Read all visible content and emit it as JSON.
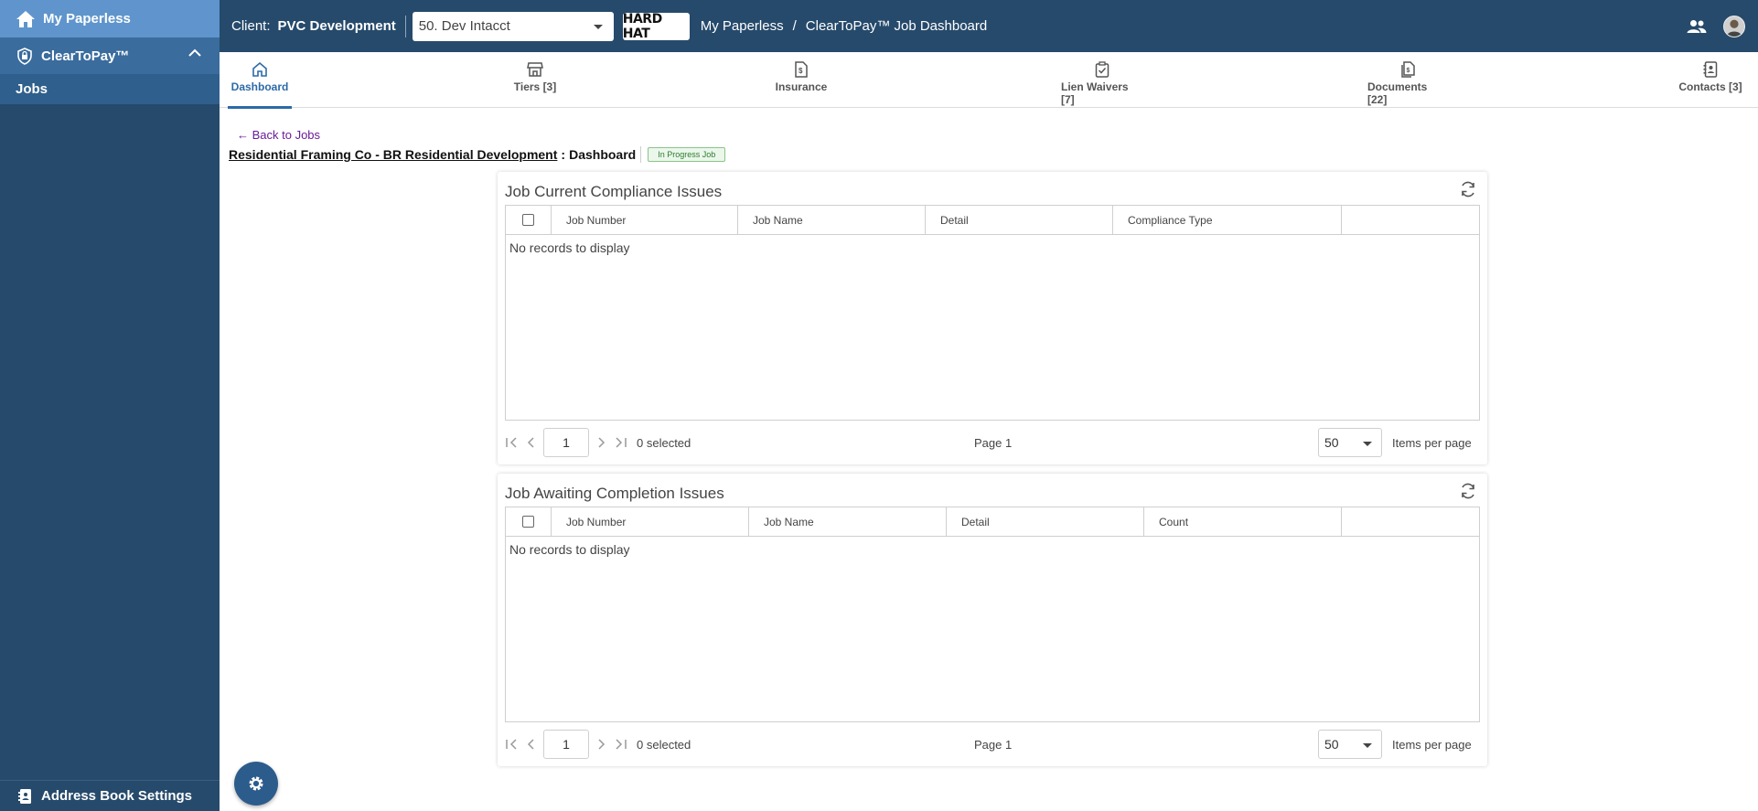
{
  "sidebar": {
    "home_label": "My Paperless",
    "section_label": "ClearToPay™",
    "items": [
      {
        "label": "Jobs"
      }
    ],
    "bottom_label": "Address Book Settings"
  },
  "topbar": {
    "client_label": "Client:",
    "client_name": "PVC Development",
    "entity_selected": "50. Dev Intacct",
    "logo_text": "HARD HAT",
    "breadcrumb": [
      "My Paperless",
      "ClearToPay™ Job Dashboard"
    ],
    "breadcrumb_separator": "/"
  },
  "tabs": [
    {
      "label": "Dashboard",
      "icon": "home-icon",
      "active": true
    },
    {
      "label": "Tiers [3]",
      "icon": "store-icon"
    },
    {
      "label": "Insurance",
      "icon": "insurance-doc-icon"
    },
    {
      "label": "Lien Waivers [7]",
      "icon": "clipboard-check-icon"
    },
    {
      "label": "Documents [22]",
      "icon": "documents-icon"
    },
    {
      "label": "Contacts [3]",
      "icon": "contacts-icon"
    }
  ],
  "header": {
    "back_link": "← Back to Jobs",
    "job_link": "Residential Framing Co - BR Residential Development",
    "colon": ":",
    "page": "Dashboard",
    "status": "In Progress Job"
  },
  "panels": [
    {
      "title": "Job Current Compliance Issues",
      "columns": [
        "Job Number",
        "Job Name",
        "Detail",
        "Compliance Type",
        ""
      ],
      "empty_text": "No records to display",
      "pager": {
        "page_input": "1",
        "selected": "0 selected",
        "page_label": "Page 1",
        "page_size": "50",
        "items_per_page": "Items per page"
      }
    },
    {
      "title": "Job Awaiting Completion Issues",
      "columns": [
        "Job Number",
        "Job Name",
        "Detail",
        "Count",
        ""
      ],
      "empty_text": "No records to display",
      "pager": {
        "page_input": "1",
        "selected": "0 selected",
        "page_label": "Page 1",
        "page_size": "50",
        "items_per_page": "Items per page"
      }
    }
  ],
  "colors": {
    "sidebar": "#264a6b",
    "topbar": "#264a6b",
    "active_tab": "#2d6aa8",
    "home_item": "#5f95cc",
    "status_green": "#2e7d32"
  }
}
